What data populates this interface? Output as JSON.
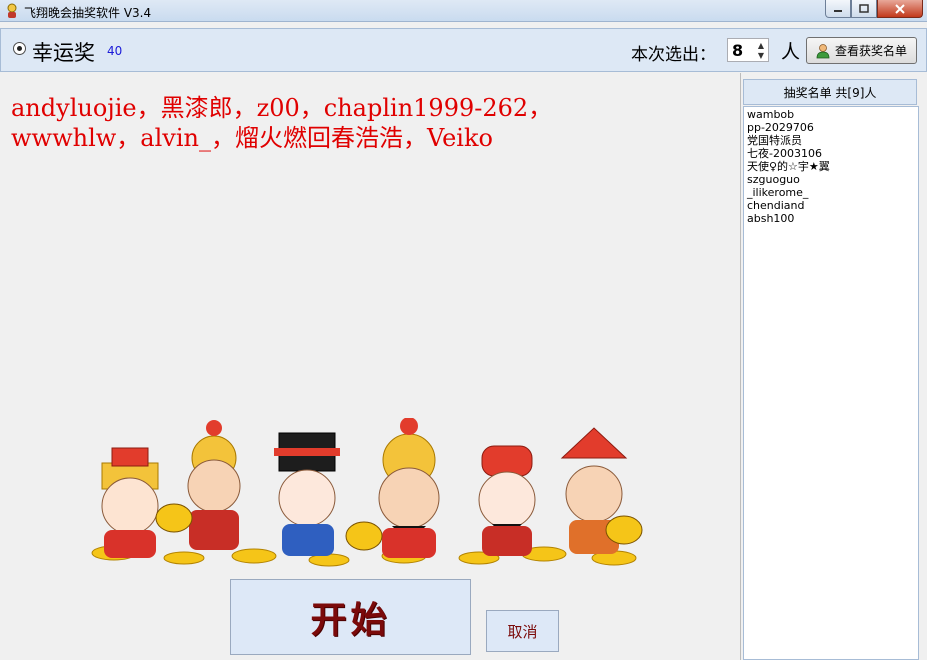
{
  "window": {
    "title": "飞翔晚会抽奖软件 V3.4"
  },
  "toolbar": {
    "prize_name": "幸运奖",
    "prize_count": "40",
    "select_label": "本次选出：",
    "select_value": "8",
    "unit": "人",
    "view_button": "查看获奖名单"
  },
  "winners": {
    "line1": "andyluojie，黑漆郎，z00，chaplin1999-262，",
    "line2": "wwwhlw，alvin_，熘火燃回春浩浩，Veiko"
  },
  "buttons": {
    "start": "开始",
    "cancel": "取消"
  },
  "side_list": {
    "header": "抽奖名单 共[9]人",
    "items": [
      "wambob",
      "pp-2029706",
      "党国特派员",
      "七夜-2003106",
      "天使♀的☆宇★翼",
      "szguoguo",
      "_ilikerome_",
      "chendiand",
      "absh100"
    ]
  },
  "colors": {
    "winner_text": "#e00000",
    "start_text": "#7b0a0a",
    "prize_count": "#1b1bd8"
  },
  "icons": [
    "app-icon",
    "minimize-icon",
    "maximize-icon",
    "close-icon",
    "user-icon",
    "spin-up-icon",
    "spin-down-icon"
  ]
}
